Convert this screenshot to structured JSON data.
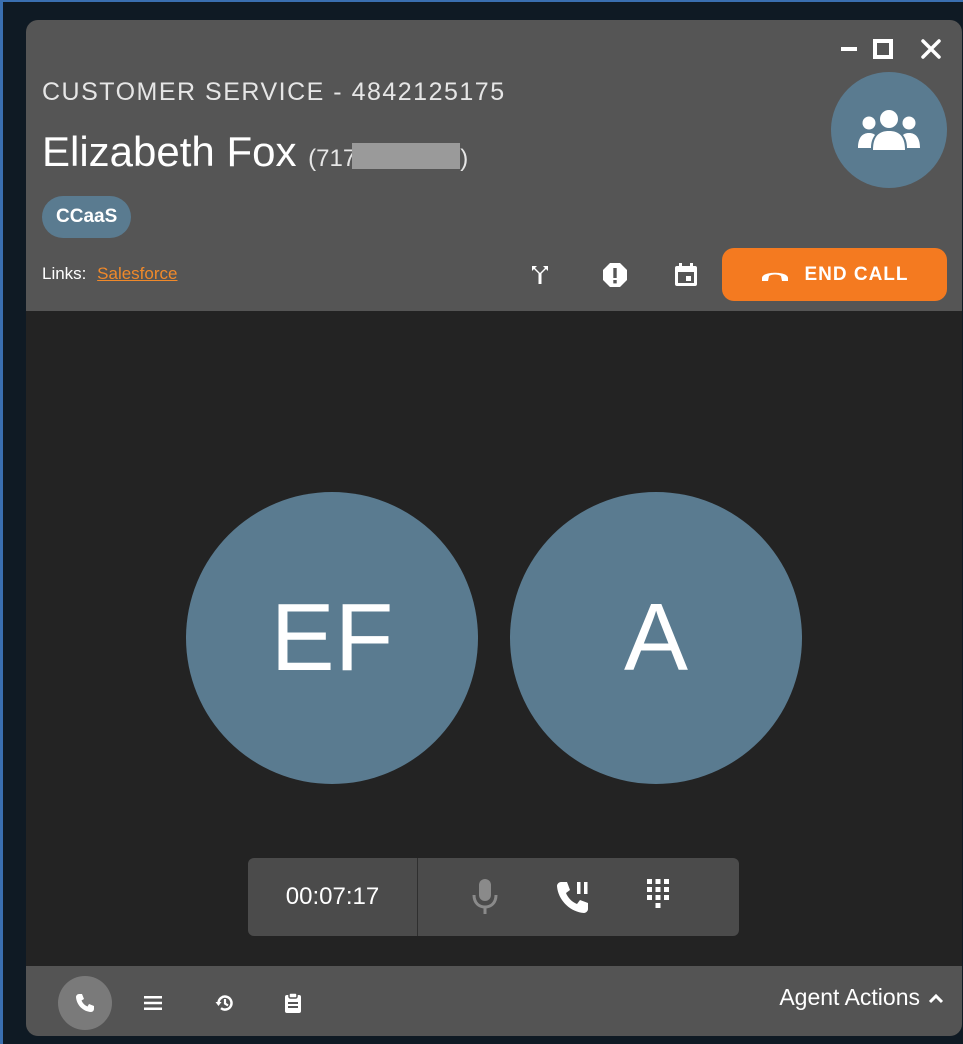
{
  "header": {
    "queue": "CUSTOMER SERVICE - 4842125175",
    "caller_name": "Elizabeth Fox",
    "caller_number_visible": "(717",
    "caller_number_end": ")",
    "tag": "CCaaS",
    "links_label": "Links:",
    "link_salesforce": "Salesforce",
    "end_call_label": "END CALL",
    "icons": [
      "merge-icon",
      "alert-icon",
      "calendar-icon",
      "phone-hangup-icon",
      "group-icon"
    ]
  },
  "window_controls": [
    "minimize-icon",
    "maximize-icon",
    "close-icon"
  ],
  "participants": [
    {
      "initials": "EF"
    },
    {
      "initials": "A"
    }
  ],
  "call_controls": {
    "timer": "00:07:17",
    "icons": [
      "microphone-icon",
      "phone-hold-icon",
      "dialpad-icon"
    ]
  },
  "footer": {
    "icons": [
      "phone-icon",
      "list-icon",
      "history-icon",
      "clipboard-icon"
    ],
    "agent_actions_label": "Agent Actions"
  },
  "colors": {
    "header_bg": "#555555",
    "body_bg": "#232323",
    "accent_orange": "#f47a20",
    "avatar_blue": "#5a7b90",
    "link_orange": "#f0892a"
  }
}
